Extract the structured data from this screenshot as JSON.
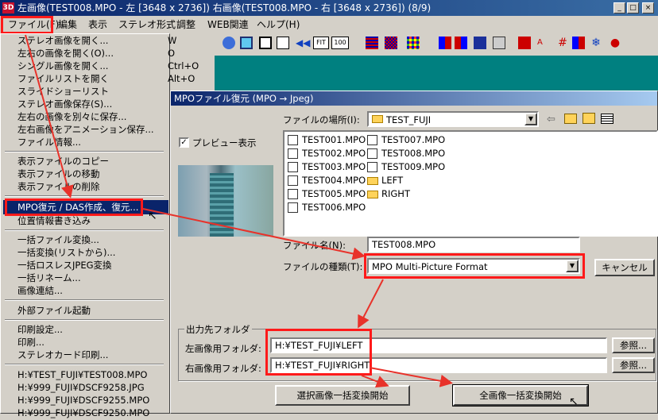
{
  "window": {
    "title": "左画像(TEST008.MPO - 左 [3648 x 2736]) 右画像(TEST008.MPO - 右 [3648 x 2736]) (8/9)",
    "icon_text": "3D"
  },
  "menubar": [
    "ファイル(F)",
    "編集",
    "表示",
    "ステレオ形式",
    "調整",
    "WEB関連",
    "ヘルプ(H)"
  ],
  "file_menu": {
    "items": [
      {
        "label": "ステレオ画像を開く...",
        "shortcut": "W"
      },
      {
        "label": "左右の画像を開く(O)...",
        "shortcut": "O"
      },
      {
        "label": "シングル画像を開く...",
        "shortcut": "Ctrl+O"
      },
      {
        "label": "ファイルリストを開く",
        "shortcut": "Alt+O"
      },
      {
        "label": "スライドショーリスト",
        "shortcut": ""
      },
      {
        "label": "ステレオ画像保存(S)...",
        "shortcut": ""
      },
      {
        "label": "左右の画像を別々に保存...",
        "shortcut": ""
      },
      {
        "label": "左右画像をアニメーション保存...",
        "shortcut": ""
      },
      {
        "label": "ファイル情報...",
        "shortcut": ""
      },
      {
        "label": "表示ファイルのコピー",
        "shortcut": ""
      },
      {
        "label": "表示ファイルの移動",
        "shortcut": ""
      },
      {
        "label": "表示ファイルの削除",
        "shortcut": ""
      },
      {
        "label": "MPO復元 / DAS作成、復元...",
        "shortcut": ""
      },
      {
        "label": "位置情報書き込み",
        "shortcut": ""
      },
      {
        "label": "一括ファイル変換...",
        "shortcut": ""
      },
      {
        "label": "一括変換(リストから)...",
        "shortcut": ""
      },
      {
        "label": "一括ロスレスJPEG変換",
        "shortcut": ""
      },
      {
        "label": "一括リネーム...",
        "shortcut": ""
      },
      {
        "label": "画像連結...",
        "shortcut": ""
      },
      {
        "label": "外部ファイル起動",
        "shortcut": ""
      },
      {
        "label": "印刷設定...",
        "shortcut": ""
      },
      {
        "label": "印刷...",
        "shortcut": ""
      },
      {
        "label": "ステレオカード印刷...",
        "shortcut": ""
      },
      {
        "label": "H:¥TEST_FUJI¥TEST008.MPO",
        "shortcut": ""
      },
      {
        "label": "H:¥999_FUJI¥DSCF9258.JPG",
        "shortcut": ""
      },
      {
        "label": "H:¥999_FUJI¥DSCF9255.MPO",
        "shortcut": ""
      },
      {
        "label": "H:¥999_FUJI¥DSCF9250.MPO",
        "shortcut": ""
      }
    ]
  },
  "toolbar": {
    "fit_label": "FIT",
    "zoom_label": "100"
  },
  "dialog": {
    "title": "MPOファイル復元 (MPO → Jpeg)",
    "location_label": "ファイルの場所(I):",
    "location_value": "TEST_FUJI",
    "preview_label": "プレビュー表示",
    "files_col1": [
      "TEST001.MPO",
      "TEST002.MPO",
      "TEST003.MPO",
      "TEST004.MPO",
      "TEST005.MPO",
      "TEST006.MPO"
    ],
    "files_col2": [
      "TEST007.MPO",
      "TEST008.MPO",
      "TEST009.MPO",
      "LEFT",
      "RIGHT"
    ],
    "filename_label": "ファイル名(N):",
    "filename_value": "TEST008.MPO",
    "filetype_label": "ファイルの種類(T):",
    "filetype_value": "MPO Multi-Picture Format",
    "cancel": "キャンセル",
    "output_group": "出力先フォルダ",
    "left_folder_label": "左画像用フォルダ:",
    "left_folder_value": "H:¥TEST_FUJI¥LEFT",
    "right_folder_label": "右画像用フォルダ:",
    "right_folder_value": "H:¥TEST_FUJI¥RIGHT",
    "browse": "参照...",
    "convert_selected": "選択画像一括変換開始",
    "convert_all": "全画像一括変換開始"
  },
  "colors": {
    "titlebar": "#0a246a",
    "highlight": "#0a246a",
    "callout": "#ff1a1a",
    "canvas": "#008080"
  }
}
